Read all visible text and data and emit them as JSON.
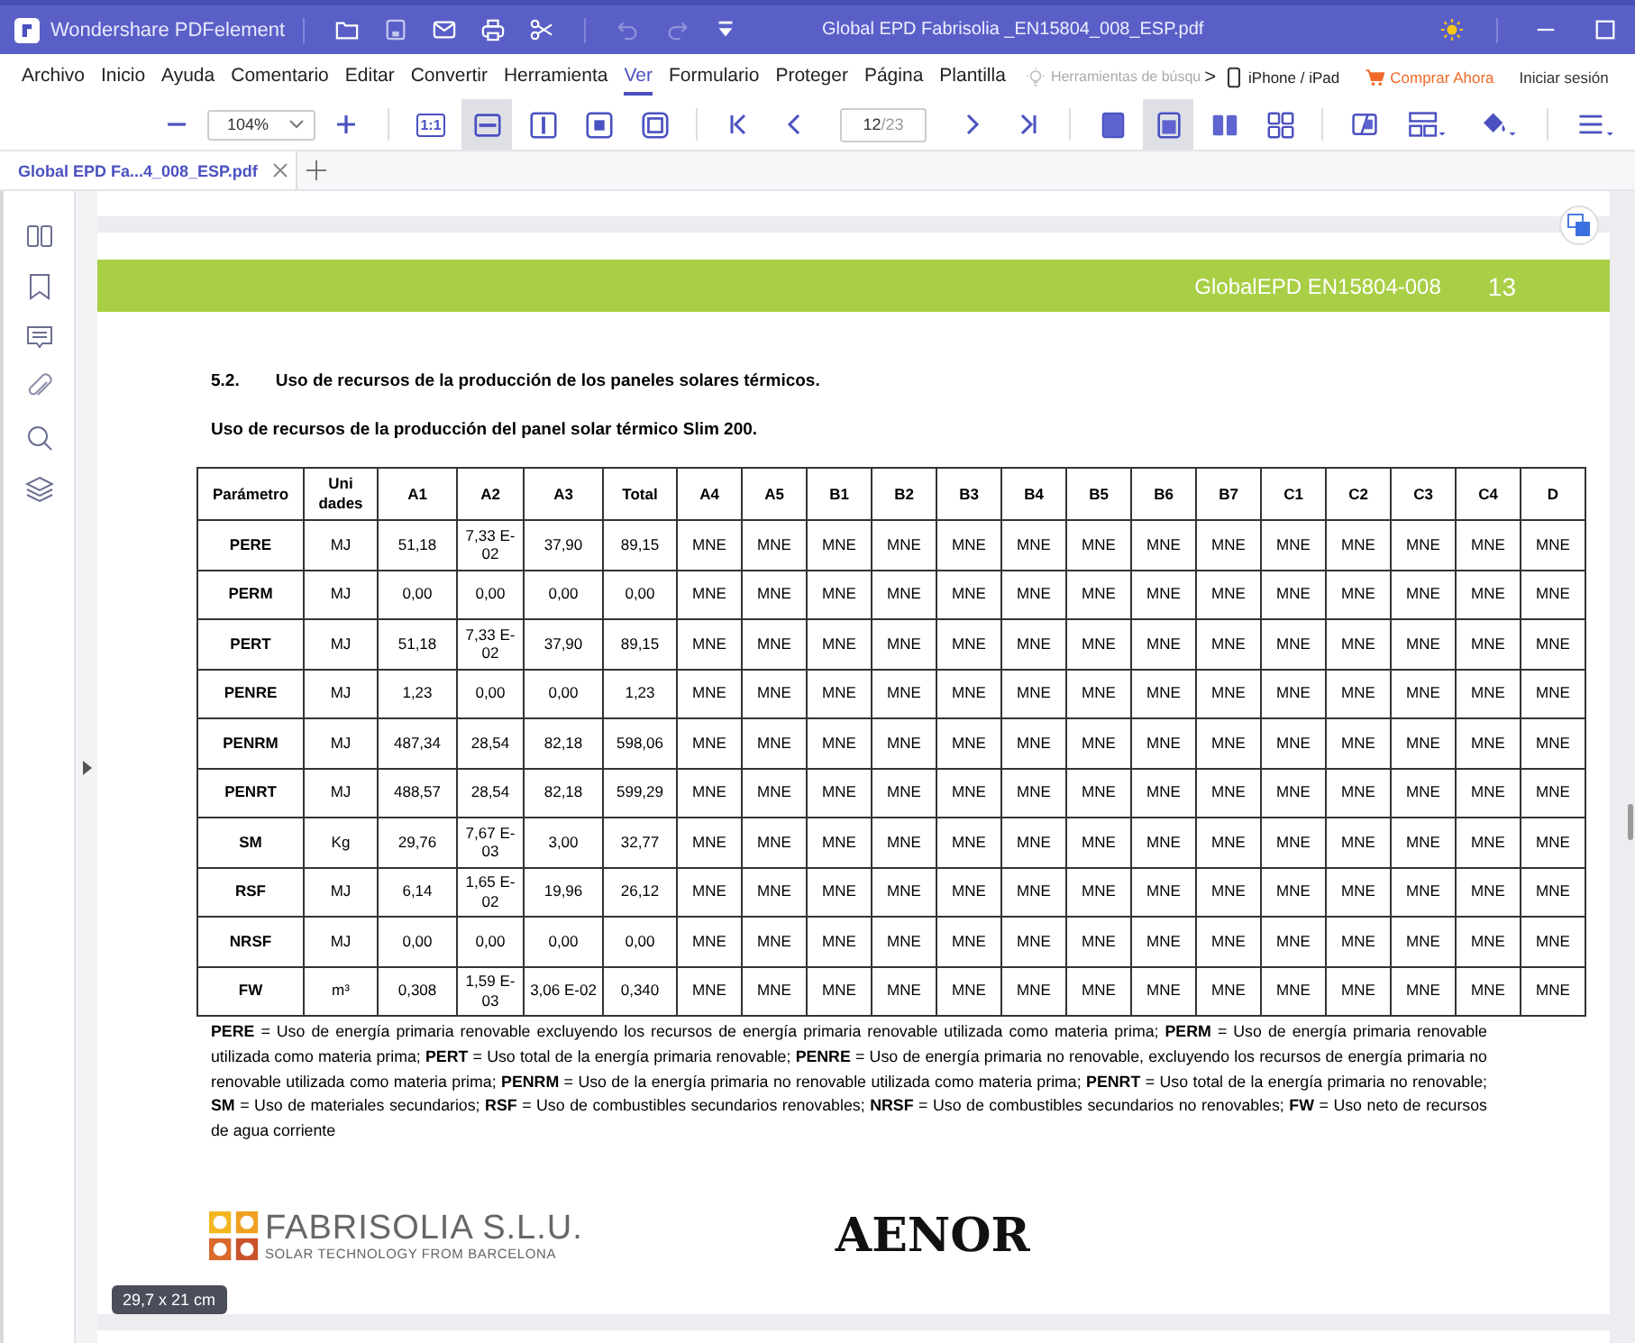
{
  "window": {
    "app_name": "Wondershare PDFelement",
    "title": "Global EPD Fabrisolia _EN15804_008_ESP.pdf"
  },
  "menu": [
    {
      "label": "Archivo",
      "selected": false
    },
    {
      "label": "Inicio",
      "selected": false
    },
    {
      "label": "Ayuda",
      "selected": false
    },
    {
      "label": "Comentario",
      "selected": false
    },
    {
      "label": "Editar",
      "selected": false
    },
    {
      "label": "Convertir",
      "selected": false
    },
    {
      "label": "Herramienta",
      "selected": false
    },
    {
      "label": "Ver",
      "selected": true
    },
    {
      "label": "Formulario",
      "selected": false
    },
    {
      "label": "Proteger",
      "selected": false
    },
    {
      "label": "Página",
      "selected": false
    },
    {
      "label": "Plantilla",
      "selected": false
    }
  ],
  "menu_right": {
    "search_hint": "Herramientas de búsqu",
    "chevron": ">",
    "devices": "iPhone / iPad",
    "buy": "Comprar Ahora",
    "login": "Iniciar sesión"
  },
  "toolbar": {
    "zoom": "104%",
    "page": "12",
    "page_total": "/23",
    "actual_size": "1:1",
    "view_buttons": [
      {
        "kind": "actual",
        "selected": false
      },
      {
        "kind": "fit-width",
        "selected": true
      },
      {
        "kind": "fit-height",
        "selected": false
      },
      {
        "kind": "fit-page",
        "selected": false
      },
      {
        "kind": "fullscreen",
        "selected": false
      }
    ],
    "layout_buttons": [
      {
        "kind": "single",
        "selected": false
      },
      {
        "kind": "continuous",
        "selected": true
      },
      {
        "kind": "two",
        "selected": false
      },
      {
        "kind": "grid",
        "selected": false
      }
    ]
  },
  "tabs": [
    {
      "label": "Global  EPD  Fa...4_008_ESP.pdf",
      "selected": true
    }
  ],
  "page": {
    "header": "GlobalEPD EN15804-008",
    "page_number": "13",
    "section_number": "5.2.",
    "section_title": "Uso de recursos de la producción de los paneles solares térmicos.",
    "table_title": "Uso de recursos de la producción del panel solar térmico Slim 200.",
    "table": {
      "columns": [
        "Parámetro",
        "Uni dades",
        "A1",
        "A2",
        "A3",
        "Total",
        "A4",
        "A5",
        "B1",
        "B2",
        "B3",
        "B4",
        "B5",
        "B6",
        "B7",
        "C1",
        "C2",
        "C3",
        "C4",
        "D"
      ],
      "rows": [
        {
          "cells": [
            "PERE",
            "MJ",
            "51,18",
            "7,33 E-02",
            "37,90",
            "89,15",
            "MNE",
            "MNE",
            "MNE",
            "MNE",
            "MNE",
            "MNE",
            "MNE",
            "MNE",
            "MNE",
            "MNE",
            "MNE",
            "MNE",
            "MNE",
            "MNE"
          ]
        },
        {
          "cells": [
            "PERM",
            "MJ",
            "0,00",
            "0,00",
            "0,00",
            "0,00",
            "MNE",
            "MNE",
            "MNE",
            "MNE",
            "MNE",
            "MNE",
            "MNE",
            "MNE",
            "MNE",
            "MNE",
            "MNE",
            "MNE",
            "MNE",
            "MNE"
          ]
        },
        {
          "cells": [
            "PERT",
            "MJ",
            "51,18",
            "7,33 E-02",
            "37,90",
            "89,15",
            "MNE",
            "MNE",
            "MNE",
            "MNE",
            "MNE",
            "MNE",
            "MNE",
            "MNE",
            "MNE",
            "MNE",
            "MNE",
            "MNE",
            "MNE",
            "MNE"
          ]
        },
        {
          "cells": [
            "PENRE",
            "MJ",
            "1,23",
            "0,00",
            "0,00",
            "1,23",
            "MNE",
            "MNE",
            "MNE",
            "MNE",
            "MNE",
            "MNE",
            "MNE",
            "MNE",
            "MNE",
            "MNE",
            "MNE",
            "MNE",
            "MNE",
            "MNE"
          ]
        },
        {
          "cells": [
            "PENRM",
            "MJ",
            "487,34",
            "28,54",
            "82,18",
            "598,06",
            "MNE",
            "MNE",
            "MNE",
            "MNE",
            "MNE",
            "MNE",
            "MNE",
            "MNE",
            "MNE",
            "MNE",
            "MNE",
            "MNE",
            "MNE",
            "MNE"
          ]
        },
        {
          "cells": [
            "PENRT",
            "MJ",
            "488,57",
            "28,54",
            "82,18",
            "599,29",
            "MNE",
            "MNE",
            "MNE",
            "MNE",
            "MNE",
            "MNE",
            "MNE",
            "MNE",
            "MNE",
            "MNE",
            "MNE",
            "MNE",
            "MNE",
            "MNE"
          ]
        },
        {
          "cells": [
            "SM",
            "Kg",
            "29,76",
            "7,67 E-03",
            "3,00",
            "32,77",
            "MNE",
            "MNE",
            "MNE",
            "MNE",
            "MNE",
            "MNE",
            "MNE",
            "MNE",
            "MNE",
            "MNE",
            "MNE",
            "MNE",
            "MNE",
            "MNE"
          ]
        },
        {
          "cells": [
            "RSF",
            "MJ",
            "6,14",
            "1,65 E-02",
            "19,96",
            "26,12",
            "MNE",
            "MNE",
            "MNE",
            "MNE",
            "MNE",
            "MNE",
            "MNE",
            "MNE",
            "MNE",
            "MNE",
            "MNE",
            "MNE",
            "MNE",
            "MNE"
          ]
        },
        {
          "cells": [
            "NRSF",
            "MJ",
            "0,00",
            "0,00",
            "0,00",
            "0,00",
            "MNE",
            "MNE",
            "MNE",
            "MNE",
            "MNE",
            "MNE",
            "MNE",
            "MNE",
            "MNE",
            "MNE",
            "MNE",
            "MNE",
            "MNE",
            "MNE"
          ]
        },
        {
          "cells": [
            "FW",
            "m³",
            "0,308",
            "1,59 E-03",
            "3,06 E-02",
            "0,340",
            "MNE",
            "MNE",
            "MNE",
            "MNE",
            "MNE",
            "MNE",
            "MNE",
            "MNE",
            "MNE",
            "MNE",
            "MNE",
            "MNE",
            "MNE",
            "MNE"
          ]
        }
      ]
    },
    "footnote": "**PERE** = Uso de energía primaria renovable excluyendo los recursos de energía primaria renovable utilizada como materia prima; **PERM** = Uso de energía primaria renovable utilizada como materia prima; **PERT** = Uso total de la energía primaria renovable; **PENRE** = Uso de energía primaria no renovable, excluyendo los recursos de energía primaria no renovable utilizada como materia prima; **PENRM** = Uso de la energía primaria no renovable utilizada como materia prima; **PENRT** = Uso total de la energía primaria no renovable; **SM** = Uso de materiales secundarios; **RSF** = Uso de combustibles secundarios renovables; **NRSF** = Uso de combustibles secundarios no renovables; **FW** = Uso neto de recursos de agua corriente",
    "logo_name": "FABRISOLIA S.L.U.",
    "logo_tagline": "SOLAR TECHNOLOGY FROM BARCELONA",
    "cert_logo": "AENOR"
  },
  "page_size": "29,7 x 21 cm"
}
